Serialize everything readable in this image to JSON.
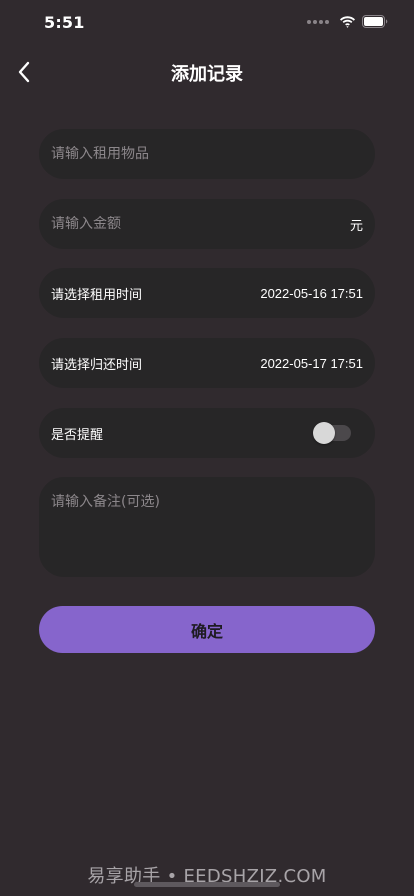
{
  "status_bar": {
    "time": "5:51",
    "icons": [
      "cellular-dots-icon",
      "wifi-icon",
      "battery-icon"
    ]
  },
  "nav": {
    "title": "添加记录",
    "back_icon": "chevron-left-icon"
  },
  "form": {
    "item": {
      "placeholder": "请输入租用物品",
      "value": ""
    },
    "amount": {
      "placeholder": "请输入金额",
      "value": "",
      "unit": "元"
    },
    "rent_time": {
      "label": "请选择租用时间",
      "value": "2022-05-16 17:51"
    },
    "return_time": {
      "label": "请选择归还时间",
      "value": "2022-05-17 17:51"
    },
    "remind": {
      "label": "是否提醒",
      "enabled": false
    },
    "note": {
      "placeholder": "请输入备注(可选)",
      "value": ""
    }
  },
  "confirm_button": {
    "label": "确定"
  },
  "watermark": "易享助手 • EEDSHZJZ.COM",
  "colors": {
    "background": "#302a2e",
    "field": "#272627",
    "accent": "#8665cc",
    "placeholder": "#8c878b"
  }
}
